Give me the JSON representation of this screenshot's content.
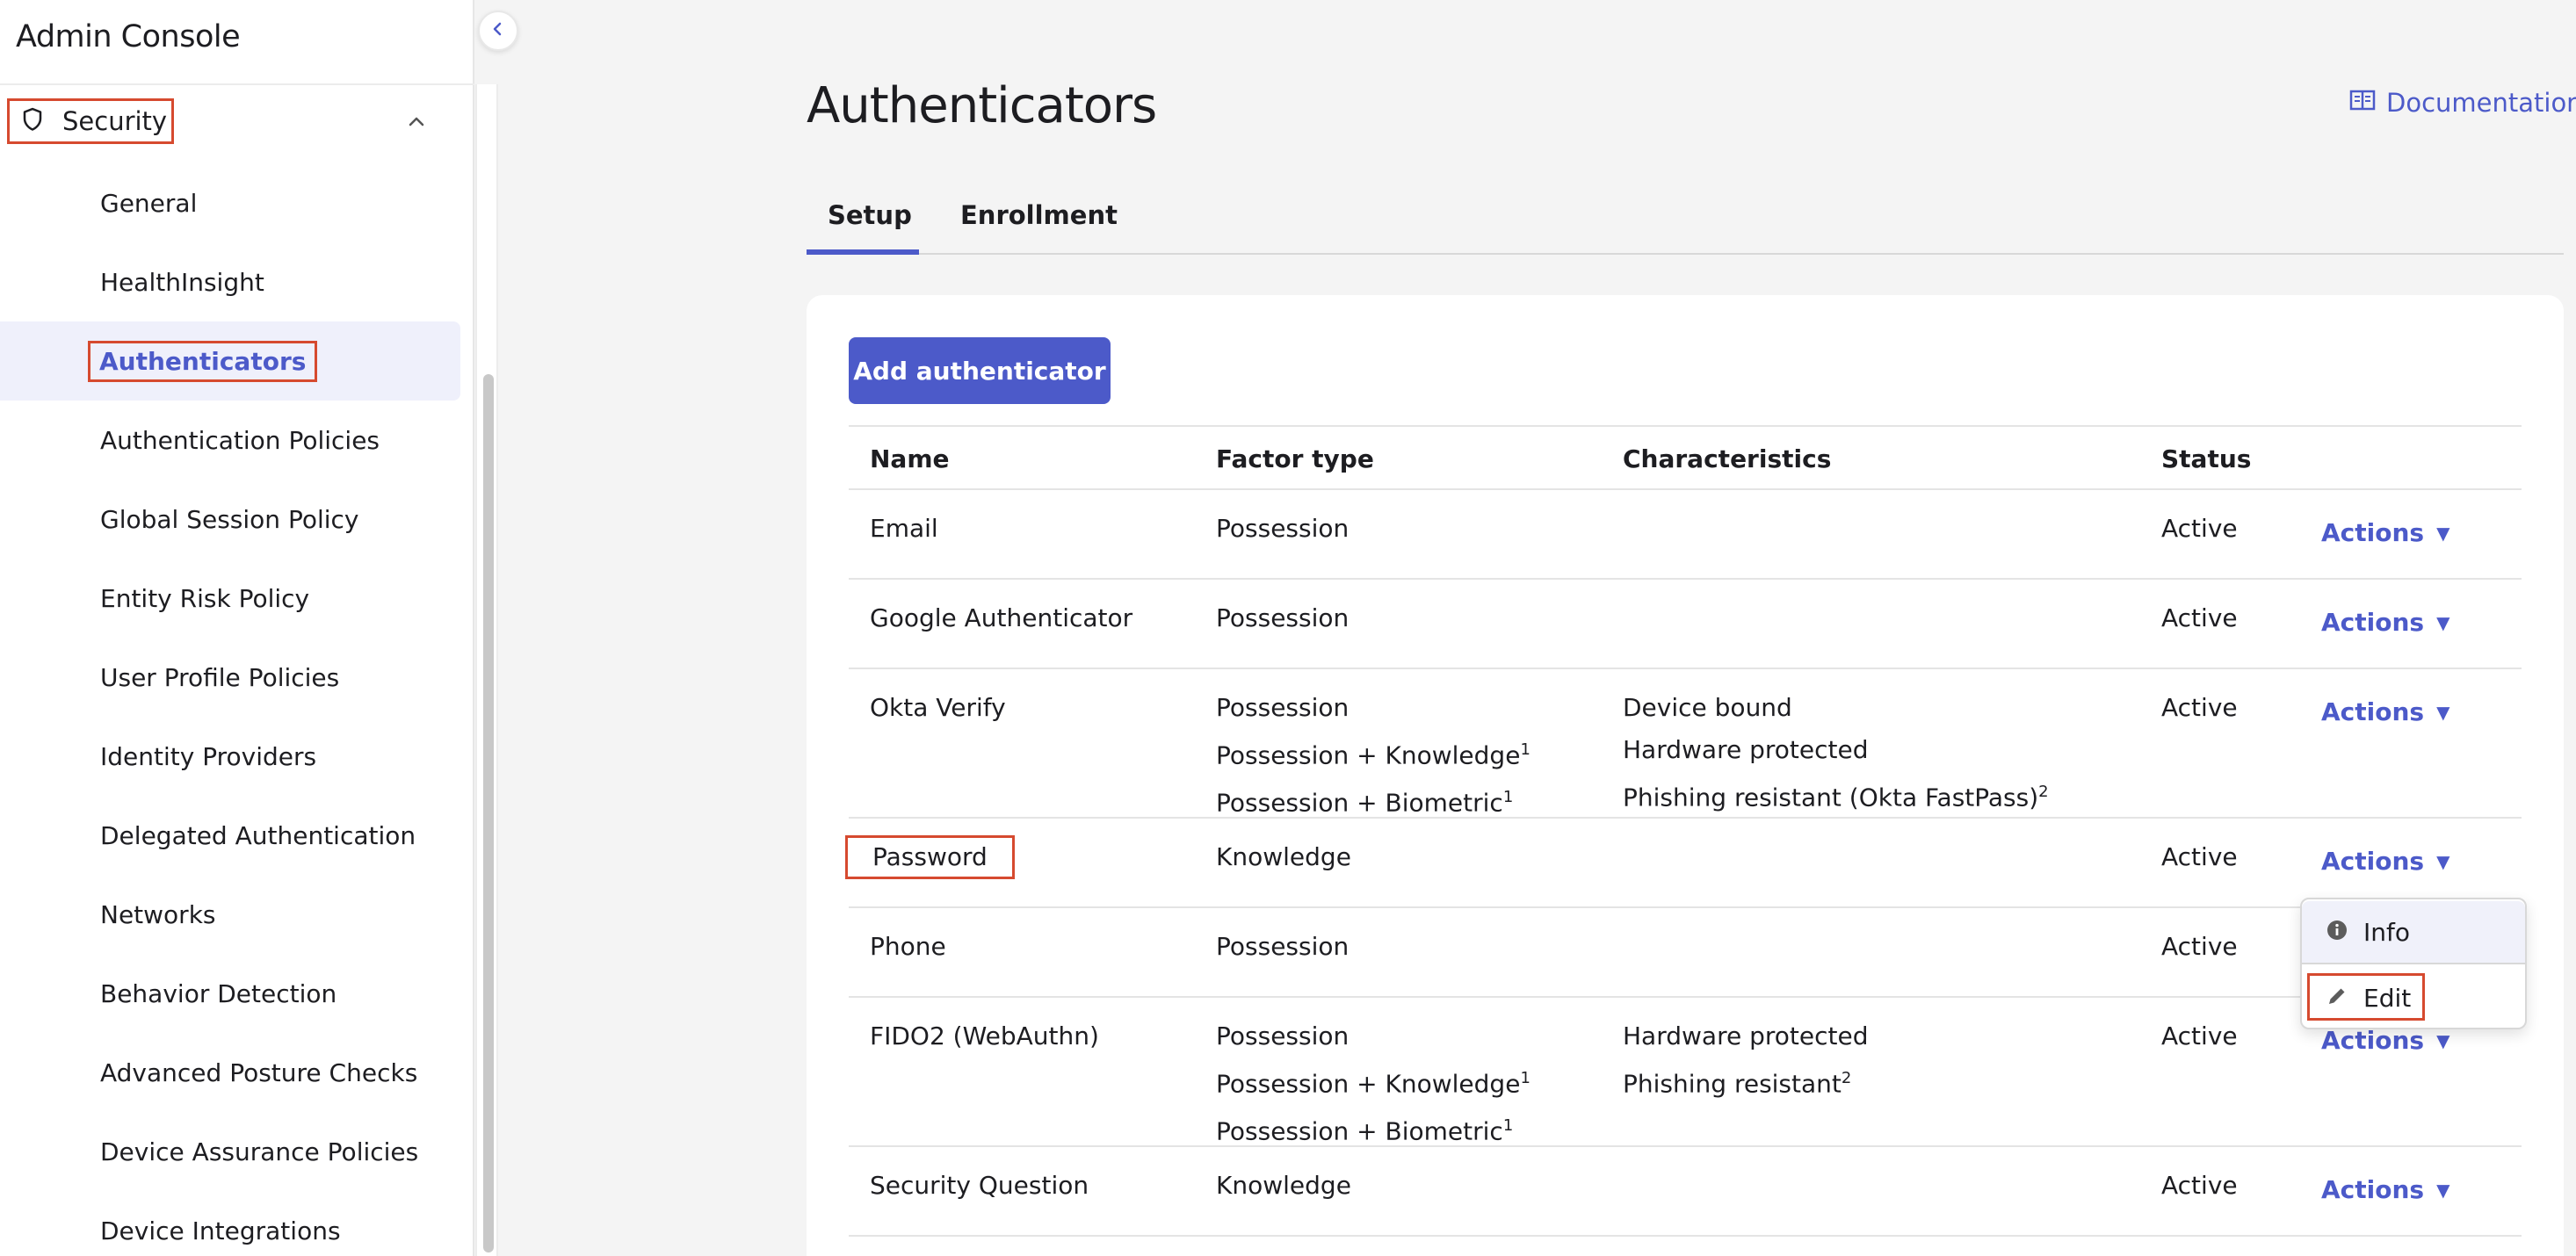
{
  "app": {
    "title": "Admin Console"
  },
  "sidebar": {
    "section": {
      "label": "Security",
      "icon": "shield-icon",
      "expanded": true
    },
    "items": [
      {
        "label": "General",
        "active": false
      },
      {
        "label": "HealthInsight",
        "active": false
      },
      {
        "label": "Authenticators",
        "active": true
      },
      {
        "label": "Authentication Policies",
        "active": false
      },
      {
        "label": "Global Session Policy",
        "active": false
      },
      {
        "label": "Entity Risk Policy",
        "active": false
      },
      {
        "label": "User Profile Policies",
        "active": false
      },
      {
        "label": "Identity Providers",
        "active": false
      },
      {
        "label": "Delegated Authentication",
        "active": false
      },
      {
        "label": "Networks",
        "active": false
      },
      {
        "label": "Behavior Detection",
        "active": false
      },
      {
        "label": "Advanced Posture Checks",
        "active": false
      },
      {
        "label": "Device Assurance Policies",
        "active": false
      },
      {
        "label": "Device Integrations",
        "active": false
      }
    ]
  },
  "header": {
    "page_title": "Authenticators",
    "documentation_label": "Documentation"
  },
  "tabs": [
    {
      "label": "Setup",
      "active": true
    },
    {
      "label": "Enrollment",
      "active": false
    }
  ],
  "toolbar": {
    "add_label": "Add authenticator"
  },
  "table": {
    "columns": [
      "Name",
      "Factor type",
      "Characteristics",
      "Status"
    ],
    "actions_label": "Actions",
    "rows": [
      {
        "name": "Email",
        "factor": [
          "Possession"
        ],
        "factor_sup": [
          ""
        ],
        "characteristics": [],
        "char_sup": [],
        "status": "Active"
      },
      {
        "name": "Google Authenticator",
        "factor": [
          "Possession"
        ],
        "factor_sup": [
          ""
        ],
        "characteristics": [],
        "char_sup": [],
        "status": "Active"
      },
      {
        "name": "Okta Verify",
        "factor": [
          "Possession",
          "Possession + Knowledge",
          "Possession + Biometric"
        ],
        "factor_sup": [
          "",
          "1",
          "1"
        ],
        "characteristics": [
          "Device bound",
          "Hardware protected",
          "Phishing resistant (Okta FastPass)"
        ],
        "char_sup": [
          "",
          "",
          "2"
        ],
        "status": "Active"
      },
      {
        "name": "Password",
        "factor": [
          "Knowledge"
        ],
        "factor_sup": [
          ""
        ],
        "characteristics": [],
        "char_sup": [],
        "status": "Active"
      },
      {
        "name": "Phone",
        "factor": [
          "Possession"
        ],
        "factor_sup": [
          ""
        ],
        "characteristics": [],
        "char_sup": [],
        "status": "Active"
      },
      {
        "name": "FIDO2 (WebAuthn)",
        "factor": [
          "Possession",
          "Possession + Knowledge",
          "Possession + Biometric"
        ],
        "factor_sup": [
          "",
          "1",
          "1"
        ],
        "characteristics": [
          "Hardware protected",
          "Phishing resistant"
        ],
        "char_sup": [
          "",
          "2"
        ],
        "status": "Active"
      },
      {
        "name": "Security Question",
        "factor": [
          "Knowledge"
        ],
        "factor_sup": [
          ""
        ],
        "characteristics": [],
        "char_sup": [],
        "status": "Active"
      }
    ]
  },
  "actions_menu": {
    "items": [
      {
        "label": "Info",
        "icon": "info-icon"
      },
      {
        "label": "Edit",
        "icon": "pencil-icon"
      }
    ]
  },
  "colors": {
    "accent": "#4c5ac9",
    "highlight_box": "#d64a2f",
    "active_nav_bg": "#eff0fb"
  }
}
